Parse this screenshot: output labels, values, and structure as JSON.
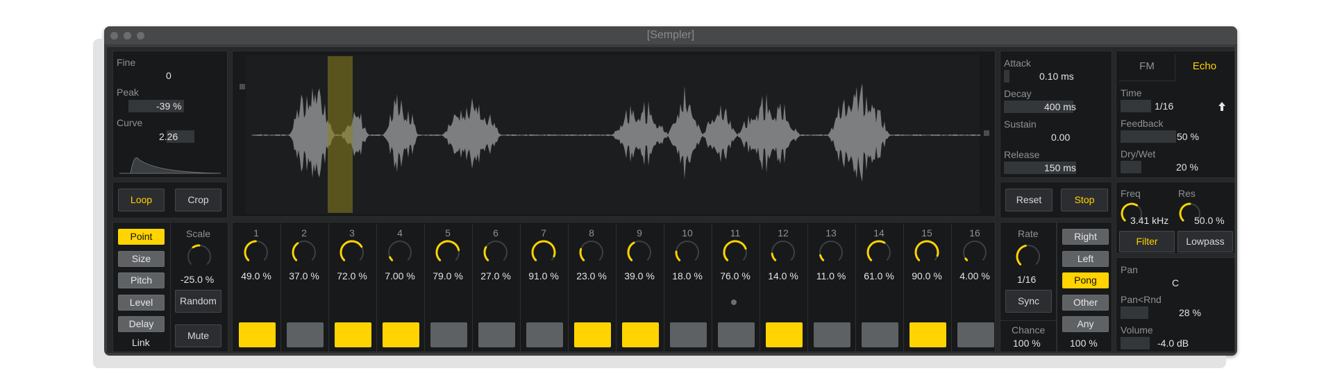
{
  "window": {
    "title": "[Sempler]"
  },
  "sample_params": {
    "fine": {
      "label": "Fine",
      "value": "0"
    },
    "peak": {
      "label": "Peak",
      "value": "-39 %"
    },
    "curve": {
      "label": "Curve",
      "value": "2.26"
    }
  },
  "envelope": {
    "attack": {
      "label": "Attack",
      "value": "0.10 ms"
    },
    "decay": {
      "label": "Decay",
      "value": "400 ms"
    },
    "sustain": {
      "label": "Sustain",
      "value": "0.00"
    },
    "release": {
      "label": "Release",
      "value": "150 ms"
    }
  },
  "fx_tabs": {
    "fm": "FM",
    "echo": "Echo",
    "active": "Echo"
  },
  "echo": {
    "time": {
      "label": "Time",
      "value": "1/16"
    },
    "feedback": {
      "label": "Feedback",
      "value": "50 %"
    },
    "drywet": {
      "label": "Dry/Wet",
      "value": "20 %"
    }
  },
  "buttons": {
    "loop": "Loop",
    "crop": "Crop",
    "reset": "Reset",
    "stop": "Stop"
  },
  "filter": {
    "freq": {
      "label": "Freq",
      "value": "3.41 kHz",
      "level": 0.62
    },
    "res": {
      "label": "Res",
      "value": "50.0 %",
      "level": 0.5
    },
    "filter_label": "Filter",
    "type": "Lowpass"
  },
  "mod_targets": {
    "items": [
      "Point",
      "Size",
      "Pitch",
      "Level",
      "Delay"
    ],
    "selected": "Point",
    "link": "Link"
  },
  "scale": {
    "label": "Scale",
    "value": "-25.0 %",
    "level": -0.25
  },
  "random_button": "Random",
  "mute_button": "Mute",
  "steps": [
    {
      "num": "1",
      "pct": "49.0 %",
      "level": 0.49,
      "active": true
    },
    {
      "num": "2",
      "pct": "37.0 %",
      "level": 0.37,
      "active": false
    },
    {
      "num": "3",
      "pct": "72.0 %",
      "level": 0.72,
      "active": true
    },
    {
      "num": "4",
      "pct": "7.00 %",
      "level": 0.07,
      "active": true
    },
    {
      "num": "5",
      "pct": "79.0 %",
      "level": 0.79,
      "active": false
    },
    {
      "num": "6",
      "pct": "27.0 %",
      "level": 0.27,
      "active": false
    },
    {
      "num": "7",
      "pct": "91.0 %",
      "level": 0.91,
      "active": false
    },
    {
      "num": "8",
      "pct": "23.0 %",
      "level": 0.23,
      "active": true
    },
    {
      "num": "9",
      "pct": "39.0 %",
      "level": 0.39,
      "active": true
    },
    {
      "num": "10",
      "pct": "18.0 %",
      "level": 0.18,
      "active": false
    },
    {
      "num": "11",
      "pct": "76.0 %",
      "level": 0.76,
      "active": false
    },
    {
      "num": "12",
      "pct": "14.0 %",
      "level": 0.14,
      "active": true
    },
    {
      "num": "13",
      "pct": "11.0 %",
      "level": 0.11,
      "active": false
    },
    {
      "num": "14",
      "pct": "61.0 %",
      "level": 0.61,
      "active": false
    },
    {
      "num": "15",
      "pct": "90.0 %",
      "level": 0.9,
      "active": true
    },
    {
      "num": "16",
      "pct": "4.00 %",
      "level": 0.04,
      "active": false
    }
  ],
  "rate": {
    "label": "Rate",
    "value": "1/16",
    "level": 0.45,
    "sync": "Sync"
  },
  "chance": {
    "label": "Chance",
    "value": "100 %"
  },
  "direction": {
    "items": [
      "Right",
      "Left",
      "Pong",
      "Other",
      "Any"
    ],
    "selected": "Pong",
    "value": "100 %"
  },
  "output": {
    "pan": {
      "label": "Pan",
      "value": "C"
    },
    "pan_rnd": {
      "label": "Pan<Rnd",
      "value": "28 %"
    },
    "volume": {
      "label": "Volume",
      "value": "-4.0 dB"
    }
  },
  "colors": {
    "accent": "#ffd400",
    "background": "#17191b",
    "waveform": "#7c7e80"
  }
}
